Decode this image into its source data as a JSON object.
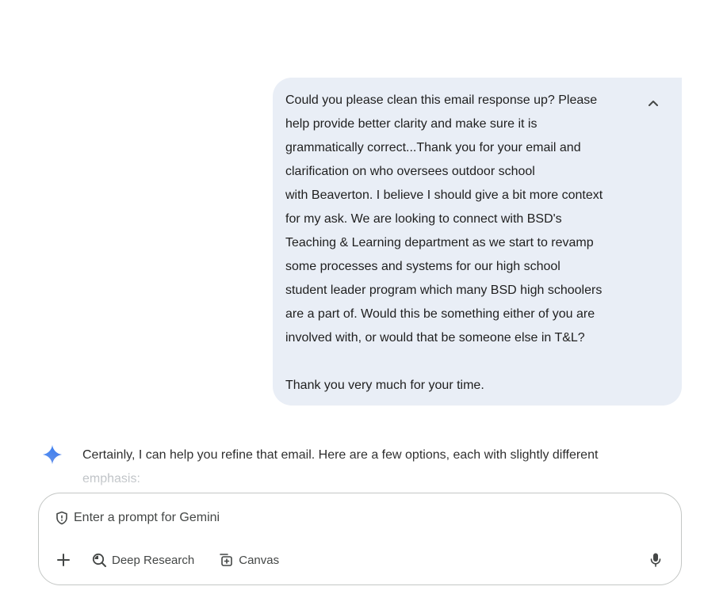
{
  "user_message": {
    "lines": [
      "Could you please clean this email response up? Please",
      "help provide better clarity and make sure it is",
      "grammatically correct...Thank you for your email and",
      "clarification on who oversees outdoor school",
      "with Beaverton. I believe I should give a bit more context",
      "for my ask. We are looking to connect with BSD's",
      "Teaching & Learning department as we start to revamp",
      "some processes and systems for our high school",
      "student leader program which many BSD high schoolers",
      "are a part of. Would this be something either of you are",
      "involved with, or would that be someone else in T&L?",
      "",
      "Thank you very much for your time."
    ],
    "collapse_icon": "chevron-up-icon"
  },
  "response": {
    "lines": [
      "Certainly, I can help you refine that email. Here are a few options, each with slightly different",
      "emphasis:"
    ],
    "avatar_icon": "gemini-spark-icon"
  },
  "prompt": {
    "placeholder": "Enter a prompt for Gemini",
    "shield_icon": "shield-icon",
    "tools": [
      {
        "label": "Deep Research",
        "icon": "deep-research-icon"
      },
      {
        "label": "Canvas",
        "icon": "canvas-icon"
      }
    ],
    "plus_icon": "plus-icon",
    "mic_icon": "microphone-icon"
  },
  "colors": {
    "bubble_bg": "#e9eef6",
    "accent_blue": "#4285f4",
    "text_primary": "#1f1f1f",
    "text_secondary": "#444746",
    "border": "#c4c7c5"
  }
}
